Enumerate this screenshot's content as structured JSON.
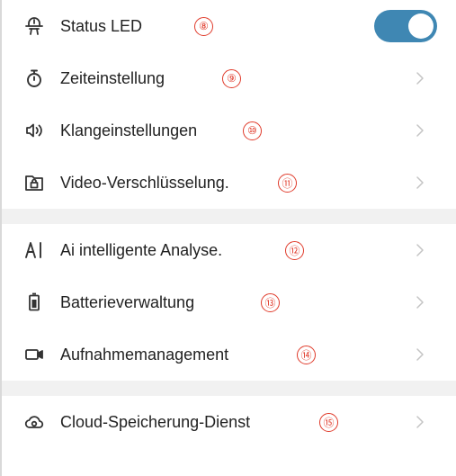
{
  "settings": {
    "group1": [
      {
        "label": "Status LED",
        "badge": "⑧",
        "icon": "status-led-icon",
        "control": "toggle",
        "toggle_on": true,
        "accent": "#3f87b3"
      },
      {
        "label": "Zeiteinstellung",
        "badge": "⑨",
        "icon": "stopwatch-icon",
        "control": "chevron"
      },
      {
        "label": "Klangeinstellungen",
        "badge": "⑩",
        "icon": "speaker-icon",
        "control": "chevron"
      },
      {
        "label": "Video-Verschlüsselung.",
        "badge": "⑪",
        "icon": "lock-folder-icon",
        "control": "chevron"
      }
    ],
    "group2": [
      {
        "label": "Ai intelligente Analyse.",
        "badge": "⑫",
        "icon": "ai-icon",
        "control": "chevron"
      },
      {
        "label": "Batterieverwaltung",
        "badge": "⑬",
        "icon": "battery-icon",
        "control": "chevron"
      },
      {
        "label": "Aufnahmemanagement",
        "badge": "⑭",
        "icon": "camera-icon",
        "control": "chevron"
      }
    ],
    "group3": [
      {
        "label": "Cloud-Speicherung-Dienst",
        "badge": "⑮",
        "icon": "cloud-icon",
        "control": "chevron"
      }
    ]
  }
}
